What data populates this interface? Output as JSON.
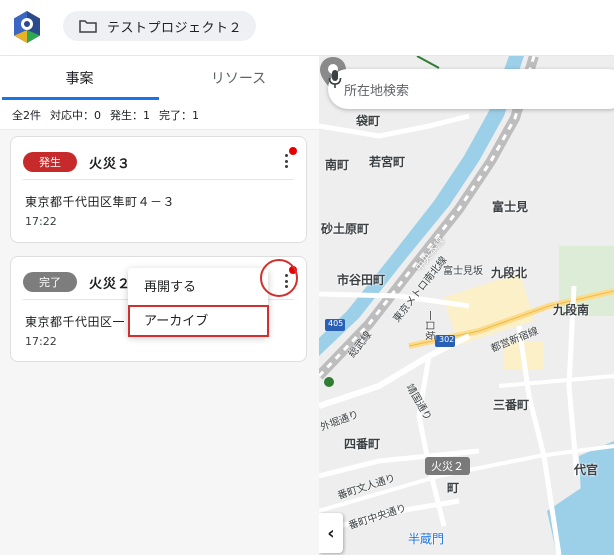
{
  "header": {
    "project_name": "テストプロジェクト２",
    "icons": {
      "logo": "app-logo-icon",
      "folder": "folder-icon"
    }
  },
  "tabs": [
    {
      "label": "事案",
      "active": true
    },
    {
      "label": "リソース",
      "active": false
    }
  ],
  "summary": {
    "total": "全2件",
    "in_progress": "対応中：0",
    "occurred": "発生：1",
    "completed": "完了：1"
  },
  "incidents": [
    {
      "status": "発生",
      "status_color": "#c62a2a",
      "title": "火災３",
      "address": "東京都千代田区隼町４－３",
      "time": "17:22",
      "unread": true
    },
    {
      "status": "完了",
      "status_color": "#7d7d7d",
      "title": "火災２",
      "address": "東京都千代田区一",
      "time": "17:22",
      "unread": true
    }
  ],
  "context_menu": {
    "items": [
      "再開する",
      "アーカイブ"
    ],
    "highlighted": "アーカイブ"
  },
  "map": {
    "search_placeholder": "所在地検索",
    "pin_label": "火災２",
    "labels": {
      "fukuromachi": "袋町",
      "minamimachi": "南町",
      "wakamiyacho": "若宮町",
      "fujimi": "富士見",
      "sunadohara": "砂土原町",
      "ichigayatamachi": "市谷田町",
      "fujimizaka": "富士見坂",
      "kudankita": "九段北",
      "kudanminami": "九段南",
      "sanbancho": "三番町",
      "yonbancho": "四番町",
      "hanzomon": "半蔵門",
      "daikan": "代官",
      "sotobori": "外堀通り",
      "chuosen": "中央本線",
      "tokyoline": "東京メトロ南北線",
      "shinjuku": "都営新宿線",
      "sobu": "総武線",
      "ichigo": "一口坂",
      "yasukuni": "靖国通り",
      "nibanchoa": "番町文人通り",
      "nibanchob": "番町中央通り",
      "road_number_a": "405",
      "road_number_b": "302",
      "ichi": "町",
      "hanzomon_icon": "subway-icon"
    }
  },
  "colors": {
    "accent": "#1a73e8",
    "alert": "#d32f2f",
    "unread_dot": "#e50000"
  }
}
